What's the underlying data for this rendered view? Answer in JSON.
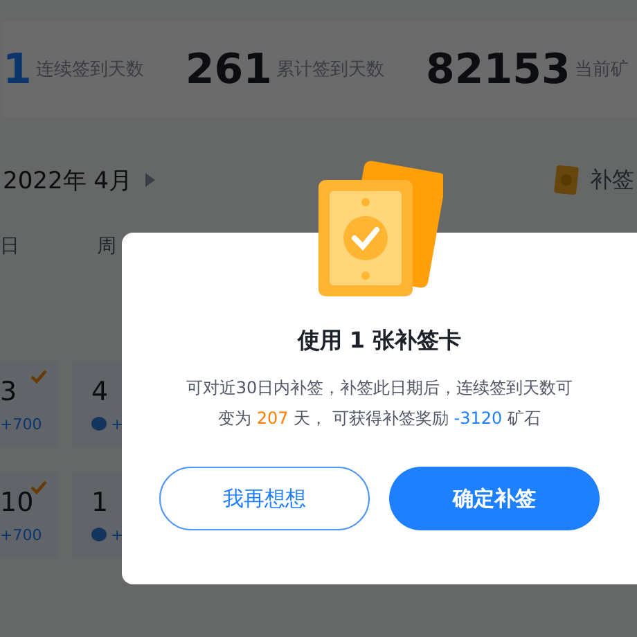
{
  "stats": [
    {
      "value": "1",
      "label": "连续签到天数",
      "accent": true
    },
    {
      "value": "261",
      "label": "累计签到天数",
      "accent": false
    },
    {
      "value": "82153",
      "label": "当前矿",
      "accent": false
    }
  ],
  "month": "2022年 4月",
  "makeup_link": "补签",
  "weekdays": [
    "日",
    "周"
  ],
  "calendar_rows": [
    [
      {
        "day": "3",
        "reward": "+700",
        "signed": true,
        "gem": false
      },
      {
        "day": "4",
        "reward": "+",
        "signed": false,
        "gem": true
      }
    ],
    [
      {
        "day": "10",
        "reward": "+700",
        "signed": true,
        "gem": false
      },
      {
        "day": "1",
        "reward": "+",
        "signed": false,
        "gem": true
      }
    ]
  ],
  "dialog": {
    "title": "使用 1 张补签卡",
    "text": "可对近30日内补签，补签此日期后，连续签到天数可变为 **207** 天， 可获得补签奖励 *-3120* 矿石",
    "buttons": [
      {
        "label": "我再想想",
        "kind": "secondary"
      },
      {
        "label": "确定补签",
        "kind": "primary"
      }
    ]
  }
}
